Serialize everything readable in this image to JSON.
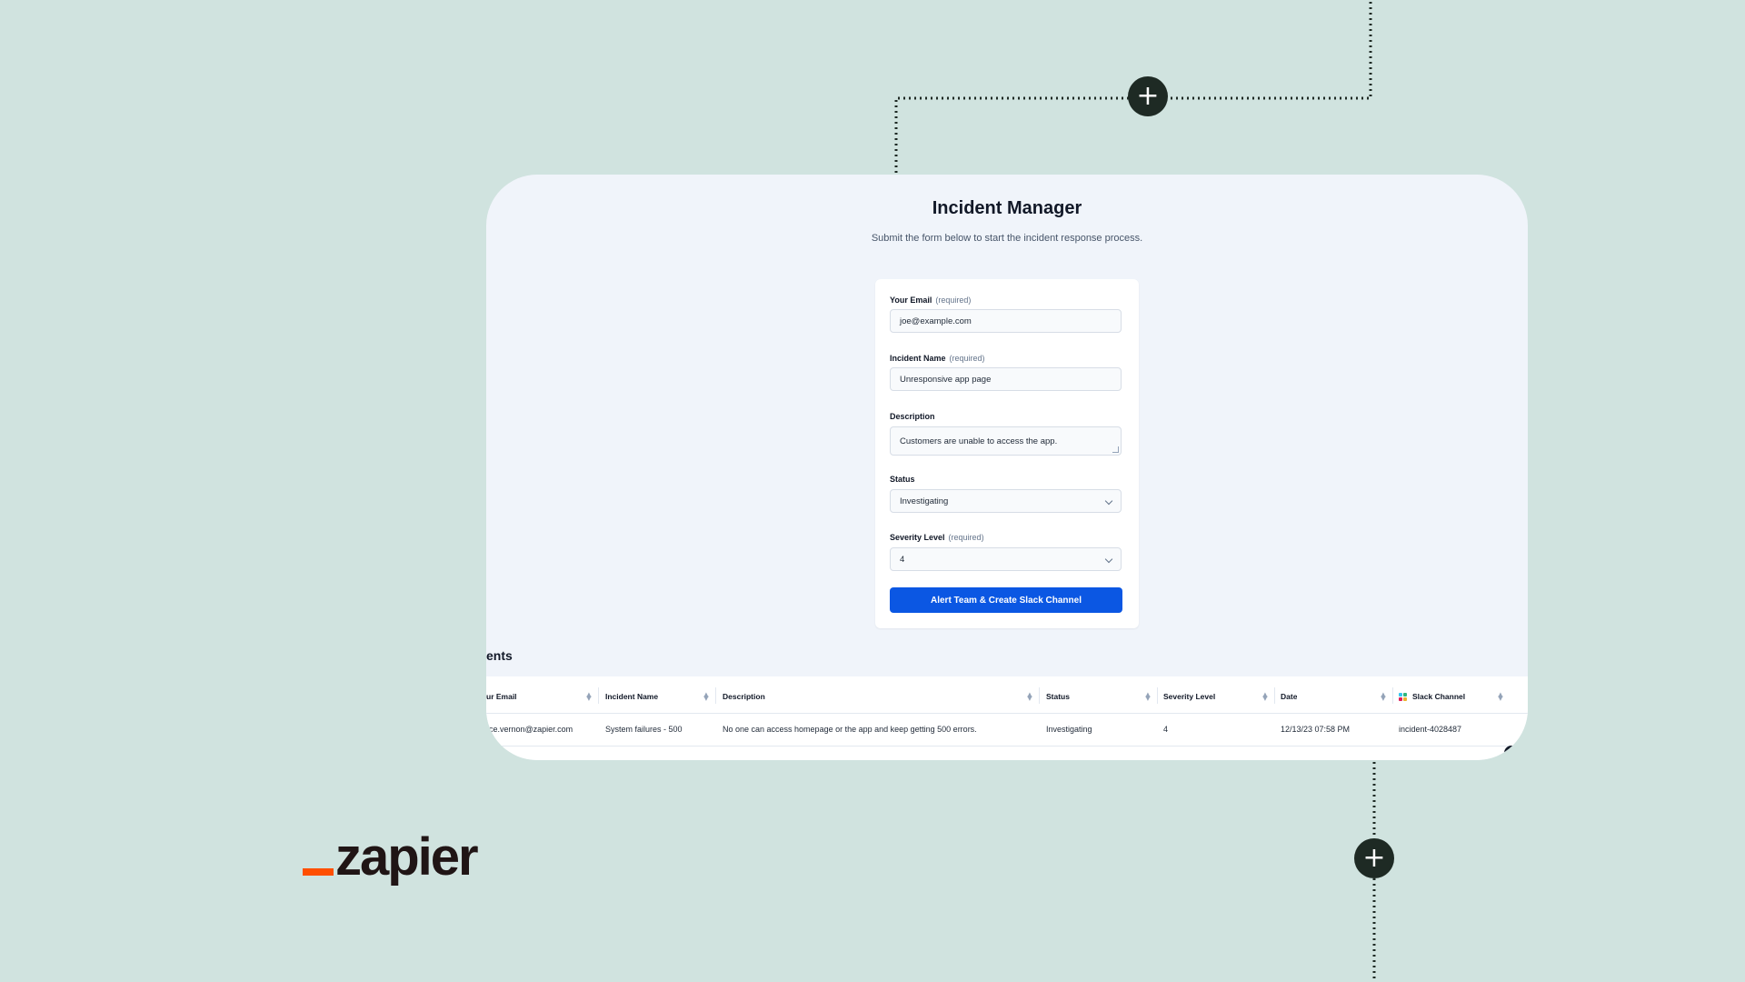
{
  "app": {
    "title": "Incident Manager",
    "subtitle": "Submit the form below to start the incident response process."
  },
  "form": {
    "email": {
      "label": "Your Email",
      "required_tag": "(required)",
      "value": "joe@example.com"
    },
    "incident_name": {
      "label": "Incident Name",
      "required_tag": "(required)",
      "value": "Unresponsive app page"
    },
    "description": {
      "label": "Description",
      "value": "Customers are unable to access the app."
    },
    "status": {
      "label": "Status",
      "value": "Investigating"
    },
    "severity": {
      "label": "Severity Level",
      "required_tag": "(required)",
      "value": "4"
    },
    "submit_label": "Alert Team & Create Slack Channel"
  },
  "incidents": {
    "heading": "ents",
    "columns": [
      "ur Email",
      "Incident Name",
      "Description",
      "Status",
      "Severity Level",
      "Date",
      "Slack Channel"
    ],
    "rows": [
      [
        "rce.vernon@zapier.com",
        "System failures - 500",
        "No one can access homepage or the app and keep getting 500 errors.",
        "Investigating",
        "4",
        "12/13/23 07:58 PM",
        "incident-4028487"
      ]
    ]
  },
  "brand": {
    "logo_text": "zapier",
    "accent": "#ff4f00",
    "primary_button": "#0b57e3",
    "background": "#d0e3df"
  },
  "icons": {
    "node": "plus-icon",
    "select": "chevron-down-icon",
    "sort": "sort-icon",
    "slack": "slack-icon"
  }
}
